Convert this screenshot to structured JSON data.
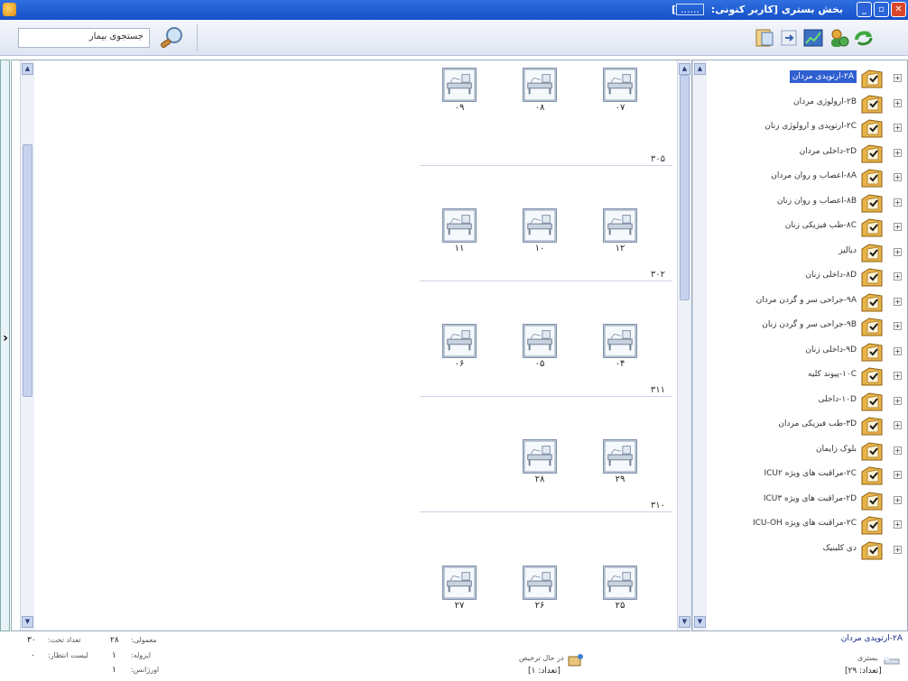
{
  "window": {
    "title": "بخش بستری [کاربر کنونی: ...... ]",
    "title_main": "بخش بستری [کاربر کنونی:",
    "title_user": "......",
    "title_tail": "]",
    "close_glyph": "✕",
    "maximize_glyph": "▫",
    "minimize_glyph": "_"
  },
  "toolbar": {
    "search_label": "جستجوی بیمار",
    "tools": [
      "refresh-icon",
      "user-add-icon",
      "chart-icon",
      "transfer-icon",
      "report-icon"
    ]
  },
  "rail": {
    "arrow": "›"
  },
  "rooms": [
    {
      "name": "",
      "beds": [
        "۰۷",
        "۰۸",
        "۰۹"
      ]
    },
    {
      "name": "۳۰۵",
      "beds": [
        "۱۲",
        "۱۰",
        "۱۱"
      ]
    },
    {
      "name": "۳۰۲",
      "beds": [
        "۰۴",
        "۰۵",
        "۰۶"
      ]
    },
    {
      "name": "۳۱۱",
      "beds": [
        "۲۹",
        "۲۸"
      ]
    },
    {
      "name": "۳۱۰",
      "beds": [
        "۲۵",
        "۲۶",
        "۲۷"
      ]
    }
  ],
  "wards": [
    {
      "label": "۲A-ارتوپدی مردان",
      "selected": true
    },
    {
      "label": "۲B-ارولوژی مردان"
    },
    {
      "label": "۲C-ارتوپدی و ارولوژی زنان"
    },
    {
      "label": "۲D-داخلی مردان"
    },
    {
      "label": "۸A-اعصاب و روان مردان"
    },
    {
      "label": "۸B-اعصاب و روان زنان"
    },
    {
      "label": "۸C-طب فیزیکی زنان"
    },
    {
      "label": "دیالیز"
    },
    {
      "label": "۸D-داخلی زنان"
    },
    {
      "label": "۹A-جراحی سر و گردن مردان"
    },
    {
      "label": "۹B-جراحی سر و گردن زنان"
    },
    {
      "label": "۹D-داخلی زنان"
    },
    {
      "label": "۱۰C-پیوند کلیه"
    },
    {
      "label": "۱۰D-داخلی"
    },
    {
      "label": "۳D-طب فیزیکی مردان"
    },
    {
      "label": "بلوک زایمان"
    },
    {
      "label": "۲C-مراقبت های ویژه ICU۲"
    },
    {
      "label": "۲D-مراقبت های ویژه ICU۳"
    },
    {
      "label": "۲C-مراقبت های ویژه ICU-OH"
    },
    {
      "label": "دی کلینیک"
    }
  ],
  "footer": {
    "ward_title": "۲A-ارتوپدی مردان",
    "stats": {
      "occupied_label": "معمولی:",
      "occupied_value": "۲۸",
      "total_label": "تعداد تخت:",
      "total_value": "۳۰",
      "vip_label": "ایزوله:",
      "vip_value": "۱",
      "waitlist_label": "لیست انتظار:",
      "waitlist_value": "۰",
      "emergency_label": "اورژانس:",
      "emergency_value": "۱"
    },
    "inpatient_label": "بستری",
    "inpatient_count": "[تعداد: ۲۹]",
    "inprogress_label": "در حال ترخیص",
    "inprogress_count": "[تعداد: ۱]"
  }
}
